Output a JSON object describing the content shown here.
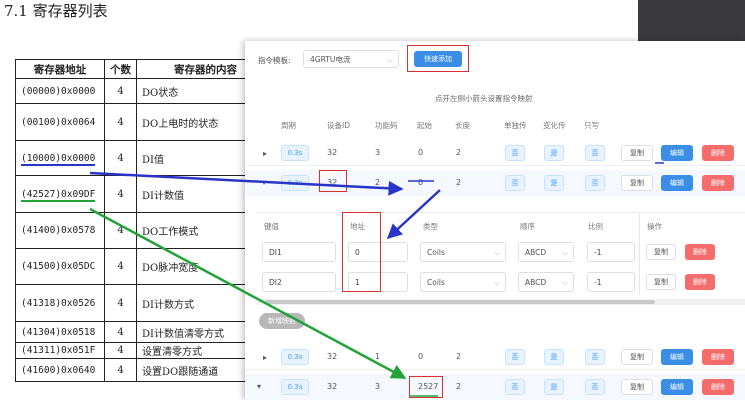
{
  "doc": {
    "title": "7.1  寄存器列表",
    "table": {
      "headers": [
        "寄存器地址",
        "个数",
        "寄存器的内容"
      ],
      "rows": [
        {
          "addr": "(00000)0x0000",
          "count": "4",
          "desc": "DO状态"
        },
        {
          "addr": "(00100)0x0064",
          "count": "4",
          "desc": "DO上电时的状态"
        },
        {
          "addr": "(10000)0x0000",
          "count": "4",
          "desc": "DI值"
        },
        {
          "addr": "(42527)0x09DF",
          "count": "4",
          "desc": "DI计数值"
        },
        {
          "addr": "(41400)0x0578",
          "count": "4",
          "desc": "DO工作模式"
        },
        {
          "addr": "(41500)0x05DC",
          "count": "4",
          "desc": "DO脉冲宽度"
        },
        {
          "addr": "(41318)0x0526",
          "count": "4",
          "desc": "DI计数方式"
        },
        {
          "addr": "(41304)0x0518",
          "count": "4",
          "desc": "DI计数值清零方式"
        },
        {
          "addr": "(41311)0x051F",
          "count": "4",
          "desc": "设置清零方式"
        },
        {
          "addr": "(41600)0x0640",
          "count": "4",
          "desc": "设置DO跟随通道"
        }
      ]
    }
  },
  "panel": {
    "template_label": "指令模板:",
    "template_value": "4GRTU电流",
    "quick_add": "快速添加",
    "hint": "点开左侧小箭头设置指令映射",
    "columns": [
      "周期",
      "设备ID",
      "功能码",
      "起始",
      "长度",
      "单独传",
      "变化传",
      "只写"
    ],
    "rows": [
      {
        "period": "0.3s",
        "device_id": "32",
        "func": "3",
        "start": "0",
        "length": "2",
        "single": "否",
        "change": "是",
        "write_only": "否"
      },
      {
        "period": "0.3s",
        "device_id": "32",
        "func": "2",
        "start": "0",
        "length": "2",
        "single": "否",
        "change": "是",
        "write_only": "否"
      },
      {
        "period": "0.3s",
        "device_id": "32",
        "func": "1",
        "start": "0",
        "length": "2",
        "single": "否",
        "change": "是",
        "write_only": "否"
      },
      {
        "period": "0.3s",
        "device_id": "32",
        "func": "3",
        "start": "2527",
        "length": "2",
        "single": "否",
        "change": "是",
        "write_only": "否"
      }
    ],
    "actions": {
      "copy": "复制",
      "edit": "编辑",
      "delete": "删除"
    },
    "sub": {
      "columns": [
        "键值",
        "地址",
        "类型",
        "顺序",
        "比例",
        "操作"
      ],
      "rows": [
        {
          "key": "DI1",
          "addr": "0",
          "type": "Coils",
          "order": "ABCD",
          "ratio": "-1"
        },
        {
          "key": "DI2",
          "addr": "1",
          "type": "Coils",
          "order": "ABCD",
          "ratio": "-1"
        }
      ],
      "add_button": "新增映射"
    }
  },
  "colors": {
    "blue_arrow": "#2a35c8",
    "green_arrow": "#22a33a",
    "highlight_red": "#d93030",
    "primary": "#3a8ee6",
    "danger": "#f56c6c"
  }
}
